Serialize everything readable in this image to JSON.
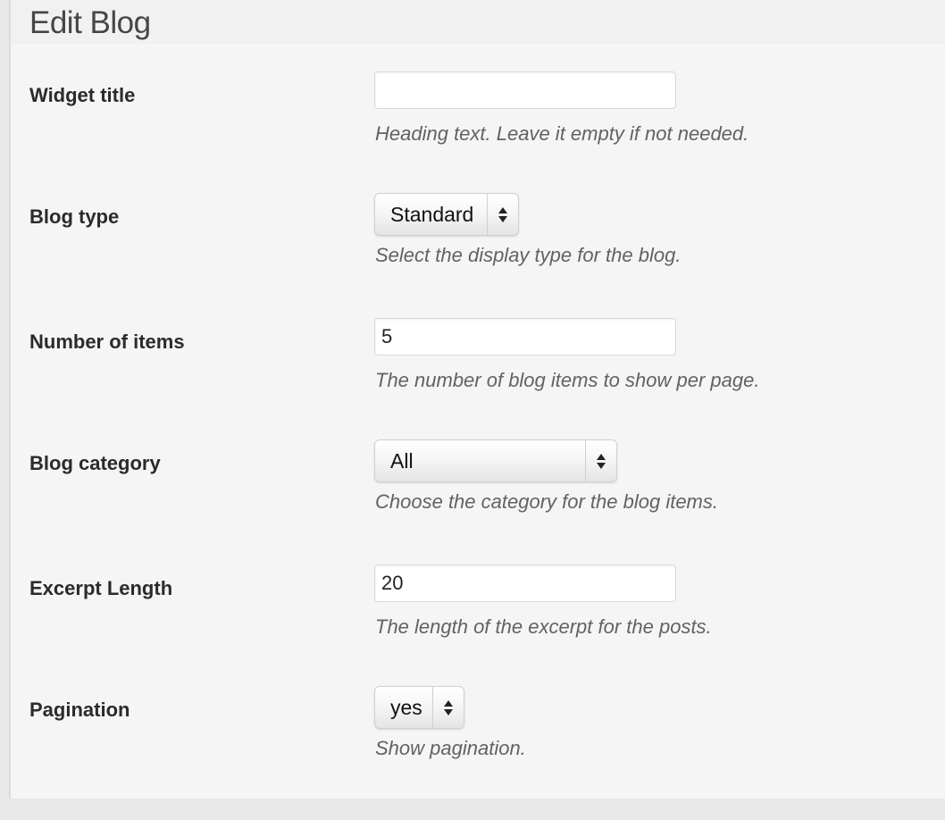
{
  "header": {
    "title": "Edit Blog"
  },
  "fields": [
    {
      "label": "Widget title",
      "type": "text",
      "value": "",
      "description": "Heading text. Leave it empty if not needed."
    },
    {
      "label": "Blog type",
      "type": "select",
      "value": "Standard",
      "description": "Select the display type for the blog."
    },
    {
      "label": "Number of items",
      "type": "text",
      "value": "5",
      "description": "The number of blog items to show per page."
    },
    {
      "label": "Blog category",
      "type": "select",
      "value": "All",
      "description": "Choose the category for the blog items."
    },
    {
      "label": "Excerpt Length",
      "type": "text",
      "value": "20",
      "description": "The length of the excerpt for the posts."
    },
    {
      "label": "Pagination",
      "type": "select",
      "value": "yes",
      "description": "Show pagination."
    }
  ],
  "icons": {
    "select_arrows": "updown-arrows-icon"
  }
}
